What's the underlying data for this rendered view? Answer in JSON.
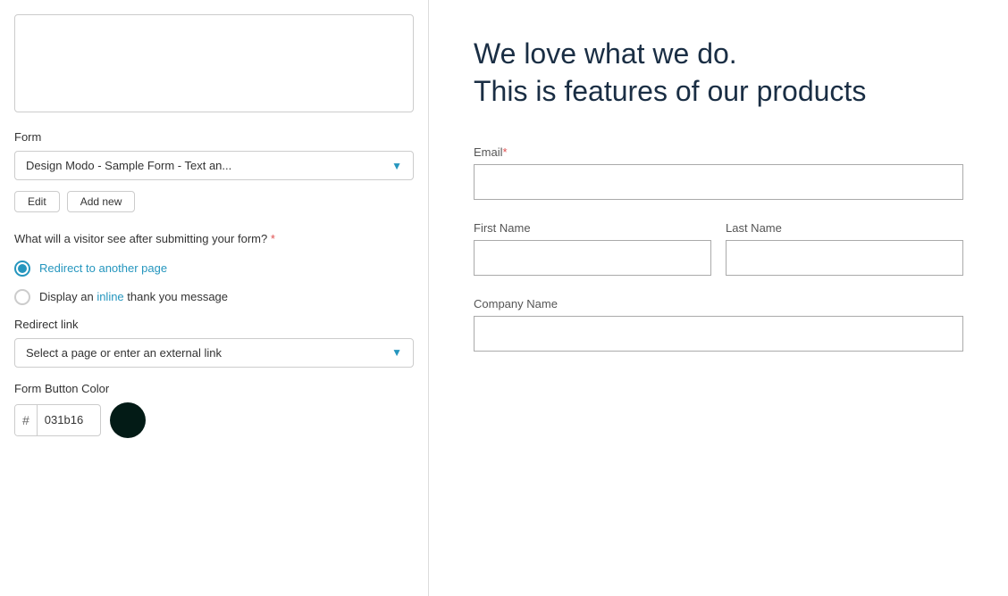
{
  "leftPanel": {
    "formLabel": "Form",
    "formDropdown": {
      "value": "Design Modo - Sample Form - Text an...",
      "arrowSymbol": "▼"
    },
    "editButton": "Edit",
    "addNewButton": "Add new",
    "questionText": "What will a visitor see after submitting your form?",
    "required": "*",
    "radioOptions": [
      {
        "id": "redirect",
        "label": "Redirect to another page",
        "checked": true
      },
      {
        "id": "inline",
        "label": "Display an inline thank you message",
        "checked": false
      }
    ],
    "redirectLinkLabel": "Redirect link",
    "redirectDropdown": {
      "value": "Select a page or enter an external link",
      "arrowSymbol": "▼"
    },
    "formButtonColorLabel": "Form Button Color",
    "colorHash": "#",
    "colorValue": "031b16",
    "colorSwatch": "#031b16"
  },
  "rightPanel": {
    "heroTitle": "We love what we do.\nThis is features of our products",
    "formFields": [
      {
        "label": "Email",
        "required": true,
        "type": "text",
        "layout": "full"
      },
      {
        "label": "First Name",
        "required": false,
        "type": "text",
        "layout": "half"
      },
      {
        "label": "Last Name",
        "required": false,
        "type": "text",
        "layout": "half"
      },
      {
        "label": "Company Name",
        "required": false,
        "type": "text",
        "layout": "full"
      }
    ]
  }
}
